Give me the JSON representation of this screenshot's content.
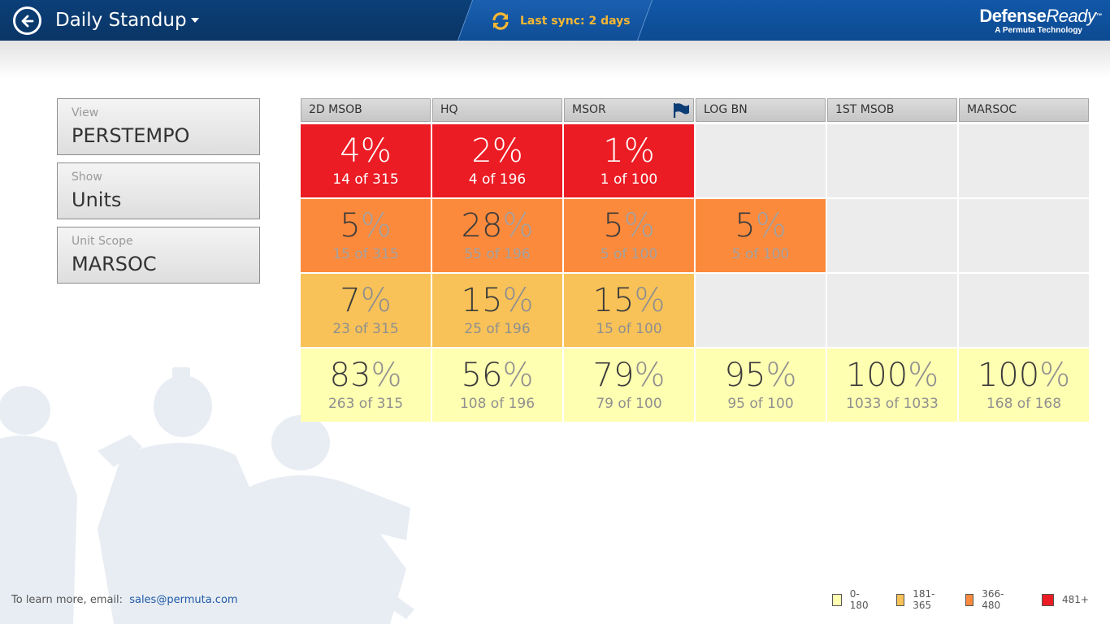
{
  "header": {
    "title": "Daily Standup",
    "sync_text": "Last sync: 2 days",
    "brand_name_bold": "Defense",
    "brand_name_italic": "Ready",
    "brand_tm": "™",
    "brand_sub": "A Permuta Technology"
  },
  "filters": [
    {
      "label": "View",
      "value": "PERSTEMPO"
    },
    {
      "label": "Show",
      "value": "Units"
    },
    {
      "label": "Unit Scope",
      "value": "MARSOC"
    }
  ],
  "columns": [
    "2D MSOB",
    "HQ",
    "MSOR",
    "LOG BN",
    "1ST MSOB",
    "MARSOC"
  ],
  "flag_column": "MSOR",
  "percent_symbol": "%",
  "rows": [
    {
      "band": "481+",
      "cells": [
        {
          "pct": "4",
          "count": "14 of 315"
        },
        {
          "pct": "2",
          "count": "4 of 196"
        },
        {
          "pct": "1",
          "count": "1 of 100"
        },
        null,
        null,
        null
      ]
    },
    {
      "band": "366-480",
      "cells": [
        {
          "pct": "5",
          "count": "15 of 315"
        },
        {
          "pct": "28",
          "count": "55 of 196"
        },
        {
          "pct": "5",
          "count": "5 of 100"
        },
        {
          "pct": "5",
          "count": "5 of 100"
        },
        null,
        null
      ]
    },
    {
      "band": "181-365",
      "cells": [
        {
          "pct": "7",
          "count": "23 of 315"
        },
        {
          "pct": "15",
          "count": "25 of 196"
        },
        {
          "pct": "15",
          "count": "15 of 100"
        },
        null,
        null,
        null
      ]
    },
    {
      "band": "0-180",
      "cells": [
        {
          "pct": "83",
          "count": "263 of 315"
        },
        {
          "pct": "56",
          "count": "108 of 196"
        },
        {
          "pct": "79",
          "count": "79 of 100"
        },
        {
          "pct": "95",
          "count": "95 of 100"
        },
        {
          "pct": "100",
          "count": "1033 of 1033"
        },
        {
          "pct": "100",
          "count": "168 of 168"
        }
      ]
    }
  ],
  "legend": [
    {
      "label": "0-180",
      "color": "#ffffb2"
    },
    {
      "label": "181-365",
      "color": "#f8c258"
    },
    {
      "label": "366-480",
      "color": "#fc8a3d"
    },
    {
      "label": "481+",
      "color": "#ec1c24"
    }
  ],
  "footer": {
    "text": "To learn more, email:",
    "email": "sales@permuta.com"
  },
  "colors": {
    "header_dark": "#0b3f78",
    "header_light": "#1158a8",
    "sync_accent": "#f7b733",
    "flag": "#0d3d75"
  }
}
